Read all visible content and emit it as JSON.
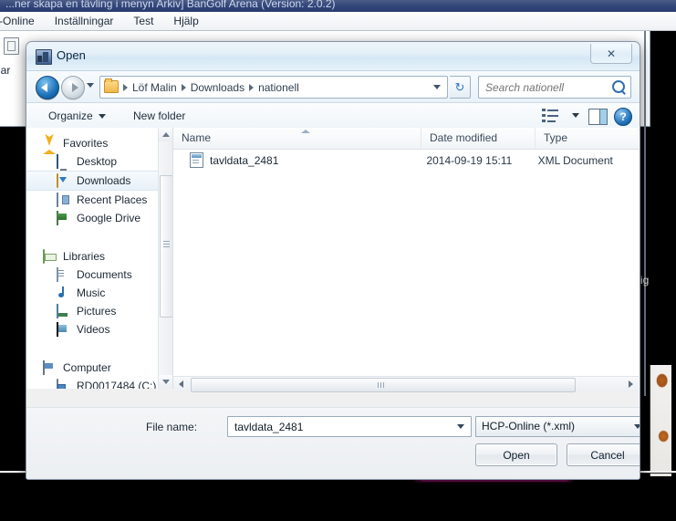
{
  "background_app": {
    "title_bar_text": "...ner skapa en tävling i menyn Arkiv]   BanGolf Arena (Version: 2.0.2)",
    "menu_items": [
      "-Online",
      "Inställningar",
      "Test",
      "Hjälp"
    ],
    "left_partial_text": "ll Bar",
    "right_partial_text": "ig"
  },
  "dialog": {
    "title": "Open",
    "title_icon": "open-folder-icon",
    "close_label": "✕",
    "nav": {
      "back_icon": "back-arrow-icon",
      "forward_icon": "forward-arrow-icon",
      "recent_icon": "recent-locations-icon",
      "refresh_icon": "↻",
      "breadcrumbs": [
        "Löf Malin",
        "Downloads",
        "nationell"
      ],
      "address_dropdown_icon": "chevron-down-icon"
    },
    "search": {
      "placeholder": "Search nationell",
      "value": "",
      "icon": "search-icon"
    },
    "toolbar": {
      "organize_label": "Organize",
      "new_folder_label": "New folder",
      "views_icon": "view-options-icon",
      "preview_icon": "preview-pane-icon",
      "help_label": "?"
    },
    "navigation_pane": {
      "sections": [
        {
          "header": {
            "label": "Favorites",
            "icon": "star-icon"
          },
          "items": [
            {
              "label": "Desktop",
              "icon": "desktop-icon",
              "selected": false
            },
            {
              "label": "Downloads",
              "icon": "downloads-icon",
              "selected": true
            },
            {
              "label": "Recent Places",
              "icon": "recent-places-icon",
              "selected": false
            },
            {
              "label": "Google Drive",
              "icon": "google-drive-icon",
              "selected": false
            }
          ]
        },
        {
          "header": {
            "label": "Libraries",
            "icon": "libraries-icon"
          },
          "items": [
            {
              "label": "Documents",
              "icon": "documents-icon",
              "selected": false
            },
            {
              "label": "Music",
              "icon": "music-icon",
              "selected": false
            },
            {
              "label": "Pictures",
              "icon": "pictures-icon",
              "selected": false
            },
            {
              "label": "Videos",
              "icon": "videos-icon",
              "selected": false
            }
          ]
        },
        {
          "header": {
            "label": "Computer",
            "icon": "computer-icon"
          },
          "items": [
            {
              "label": "RD0017484 (C:)",
              "icon": "hard-drive-icon",
              "selected": false
            }
          ]
        }
      ]
    },
    "file_list": {
      "columns": [
        "Name",
        "Date modified",
        "Type"
      ],
      "sort_column": "Name",
      "sort_direction": "ascending",
      "rows": [
        {
          "name": "tavldata_2481",
          "date_modified": "2014-09-19 15:11",
          "type": "XML Document",
          "icon": "xml-file-icon"
        }
      ]
    },
    "footer": {
      "file_name_label": "File name:",
      "file_name_value": "tavldata_2481",
      "file_name_placeholder": "",
      "filter_value": "HCP-Online (*.xml)",
      "open_button": "Open",
      "cancel_button": "Cancel"
    }
  },
  "colors": {
    "accent_blue": "#2f78c4",
    "selection": "#e8f1f8",
    "magenta_bar": "#e6149a",
    "title_gradient": "#32467a"
  }
}
